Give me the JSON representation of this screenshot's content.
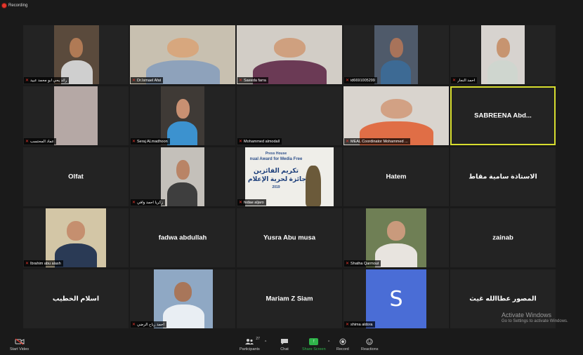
{
  "recording": {
    "label": "Recording"
  },
  "tiles": [
    {
      "name": "رائد يحي ابو محمد عبيد",
      "type": "video",
      "bg": "#5a4a3c",
      "skin": "#b07a55",
      "shirt": "#cfcfcf"
    },
    {
      "name": "Dr.Ismael Afat",
      "type": "video",
      "bg": "#c8c0b0",
      "skin": "#d7a77e",
      "shirt": "#8ea2bb"
    },
    {
      "name": "Saeeda farra",
      "type": "video",
      "bg": "#d2cdc6",
      "skin": "#cfa07f",
      "shirt": "#6b3a55"
    },
    {
      "name": "id6691005299",
      "type": "video",
      "bg": "#4f5a6a",
      "skin": "#a8735a",
      "shirt": "#3d6a94"
    },
    {
      "name": "أحمد النجار",
      "type": "video",
      "bg": "#d7d3cf",
      "skin": "#c79470",
      "shirt": "#cfd6cf"
    },
    {
      "name": "عماد المحتسب",
      "type": "video",
      "bg": "#b5a8a5",
      "skin": "#b5a8a5",
      "shirt": "#b5a8a5"
    },
    {
      "name": "Seraj ALmadhoon",
      "type": "video",
      "bg": "#3f3a36",
      "skin": "#c89072",
      "shirt": "#3c92cf"
    },
    {
      "name": "Mohammed almodall",
      "type": "blank"
    },
    {
      "name": "MEAL Coordinator Mohammed ...",
      "type": "video",
      "bg": "#d9d4ce",
      "skin": "#d2a184",
      "shirt": "#e06e46"
    },
    {
      "name": "SABREENA  Abd...",
      "type": "label",
      "active": true
    },
    {
      "name": "Olfat",
      "type": "label"
    },
    {
      "name": "زكريا احمد وافي",
      "type": "video",
      "bg": "#c4c0ba",
      "skin": "#b98466",
      "shirt": "#3e3e3e"
    },
    {
      "name": "fedae aljaro",
      "type": "poster"
    },
    {
      "name": "Hatem",
      "type": "label"
    },
    {
      "name": "الاستاذة سامية مقاط",
      "type": "label"
    },
    {
      "name": "Ibrahim abu alash",
      "type": "video",
      "bg": "#d3c6a6",
      "skin": "#c58f6f",
      "shirt": "#2a3a55"
    },
    {
      "name": "fadwa abdullah",
      "type": "label"
    },
    {
      "name": "Yusra Abu musa",
      "type": "label"
    },
    {
      "name": "Shatha Qarmout",
      "type": "video",
      "bg": "#6f7f55",
      "skin": "#c99a7c",
      "shirt": "#e8e4df"
    },
    {
      "name": "zainab",
      "type": "label"
    },
    {
      "name": "اسلام الخطيب",
      "type": "label"
    },
    {
      "name": "احمد رياح الرضي",
      "type": "video",
      "bg": "#8fa8c4",
      "skin": "#a8765a",
      "shirt": "#e9eef3"
    },
    {
      "name": "Mariam Z Siam",
      "type": "label"
    },
    {
      "name": "shima aldora",
      "type": "avatar",
      "letter": "S"
    },
    {
      "name": "المصور عطاالله غيث",
      "type": "label"
    }
  ],
  "poster": {
    "line1": "Press House",
    "line2": "nual Award for Media Free",
    "line3": "تكريم الفائزين",
    "line4": "جائزة لحرية الإعلام",
    "line5": "2019"
  },
  "watermark": {
    "title": "Activate Windows",
    "subtitle": "Go to Settings to activate Windows."
  },
  "toolbar": {
    "start_video": "Start Video",
    "participants": "Participants",
    "participants_count": "27",
    "chat": "Chat",
    "share_screen": "Share Screen",
    "record": "Record",
    "reactions": "Reactions"
  },
  "colors": {
    "accent": "#d7dd2f",
    "share": "#2fb34a",
    "muted": "#e5362c",
    "avatar": "#4a6dd6"
  }
}
